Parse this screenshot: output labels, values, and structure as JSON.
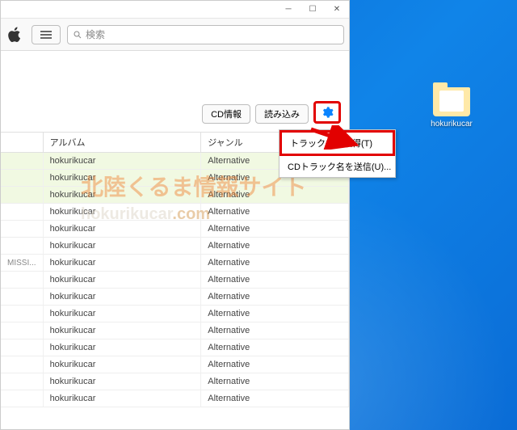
{
  "desktop": {
    "icon_label": "hokurikucar"
  },
  "window": {
    "search_placeholder": "検索",
    "buttons": {
      "cd_info": "CD情報",
      "import": "読み込み"
    },
    "menu": {
      "get_track_names": "トラック名を取得(T)",
      "send_track_names": "CDトラック名を送信(U)..."
    },
    "headers": {
      "num": "",
      "album": "アルバム",
      "genre": "ジャンル"
    },
    "rows": [
      {
        "num": "",
        "album": "hokurikucar",
        "genre": "Alternative"
      },
      {
        "num": "",
        "album": "hokurikucar",
        "genre": "Alternative"
      },
      {
        "num": "",
        "album": "hokurikucar",
        "genre": "Alternative"
      },
      {
        "num": "",
        "album": "hokurikucar",
        "genre": "Alternative"
      },
      {
        "num": "",
        "album": "hokurikucar",
        "genre": "Alternative"
      },
      {
        "num": "",
        "album": "hokurikucar",
        "genre": "Alternative"
      },
      {
        "num": "MISSI...",
        "album": "hokurikucar",
        "genre": "Alternative"
      },
      {
        "num": "",
        "album": "hokurikucar",
        "genre": "Alternative"
      },
      {
        "num": "",
        "album": "hokurikucar",
        "genre": "Alternative"
      },
      {
        "num": "",
        "album": "hokurikucar",
        "genre": "Alternative"
      },
      {
        "num": "",
        "album": "hokurikucar",
        "genre": "Alternative"
      },
      {
        "num": "",
        "album": "hokurikucar",
        "genre": "Alternative"
      },
      {
        "num": "",
        "album": "hokurikucar",
        "genre": "Alternative"
      },
      {
        "num": "",
        "album": "hokurikucar",
        "genre": "Alternative"
      },
      {
        "num": "",
        "album": "hokurikucar",
        "genre": "Alternative"
      }
    ]
  },
  "watermark": {
    "line1": "北陸くるま情報サイト",
    "line2a": "hokurikucar",
    "line2b": ".com"
  }
}
